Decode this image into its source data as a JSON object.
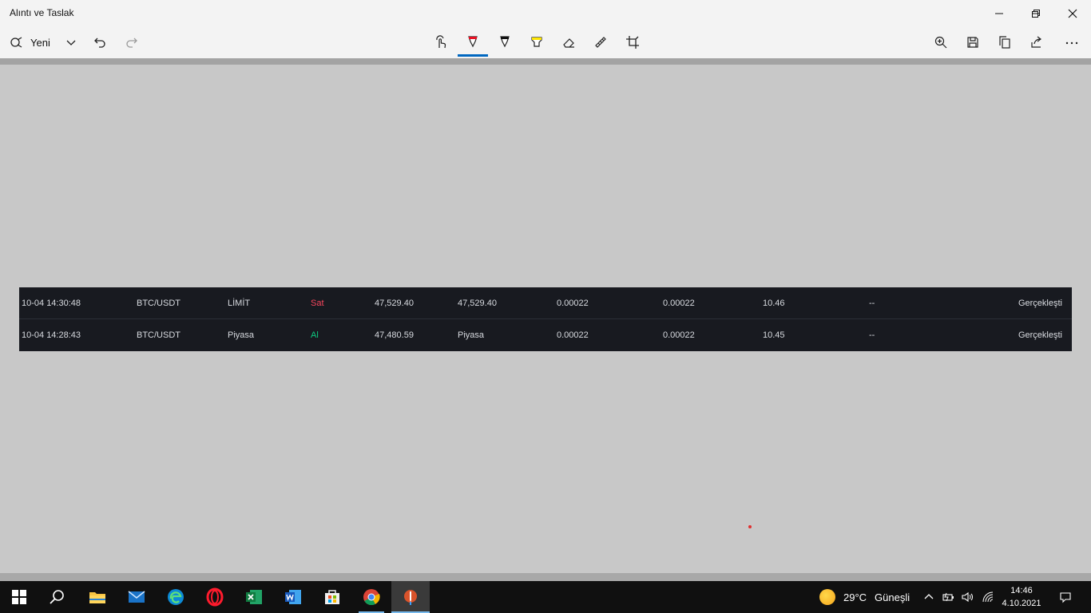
{
  "window": {
    "title": "Alıntı ve Taslak"
  },
  "toolbar": {
    "new_label": "Yeni",
    "accent_color": "#0067c0"
  },
  "orders": {
    "rows": [
      {
        "time": "10-04 14:30:48",
        "pair": "BTC/USDT",
        "type": "LİMİT",
        "side": "Sat",
        "price": "47,529.40",
        "average": "47,529.40",
        "amount": "0.00022",
        "filled": "0.00022",
        "total": "10.46",
        "trigger": "--",
        "status": "Gerçekleşti"
      },
      {
        "time": "10-04 14:28:43",
        "pair": "BTC/USDT",
        "type": "Piyasa",
        "side": "Al",
        "price": "47,480.59",
        "average": "Piyasa",
        "amount": "0.00022",
        "filled": "0.00022",
        "total": "10.45",
        "trigger": "--",
        "status": "Gerçekleşti"
      }
    ],
    "sell_color": "#f6465d",
    "buy_color": "#0ecb81"
  },
  "taskbar": {
    "weather_temp": "29°C",
    "weather_condition": "Güneşli",
    "time": "14:46",
    "date": "4.10.2021",
    "apps": [
      "start-icon",
      "search-icon",
      "file-explorer-icon",
      "mail-icon",
      "edge-icon",
      "opera-icon",
      "excel-icon",
      "word-icon",
      "store-icon",
      "chrome-icon",
      "snip-sketch-icon"
    ]
  }
}
